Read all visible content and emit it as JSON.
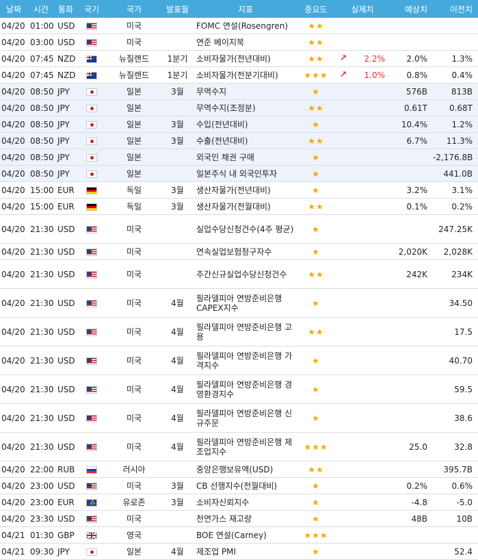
{
  "headers": [
    "날짜",
    "시간",
    "통화",
    "국기",
    "국가",
    "발표월",
    "지표",
    "중요도",
    "실제치",
    "예상치",
    "이전치"
  ],
  "rows": [
    {
      "date": "04/20",
      "time": "01:00",
      "cur": "USD",
      "flag": "us",
      "country": "미국",
      "month": "",
      "indicator": "FOMC 연설(Rosengren)",
      "stars": "★★",
      "arrow": "",
      "actual": "",
      "forecast": "",
      "previous": "",
      "hl": false
    },
    {
      "date": "04/20",
      "time": "03:00",
      "cur": "USD",
      "flag": "us",
      "country": "미국",
      "month": "",
      "indicator": "연준 베이지북",
      "stars": "★★",
      "arrow": "",
      "actual": "",
      "forecast": "",
      "previous": "",
      "hl": false
    },
    {
      "date": "04/20",
      "time": "07:45",
      "cur": "NZD",
      "flag": "nz",
      "country": "뉴질랜드",
      "month": "1분기",
      "indicator": "소비자물가(전년대비)",
      "stars": "★★",
      "arrow": "↗",
      "actual": "2.2%",
      "forecast": "2.0%",
      "previous": "1.3%",
      "hl": false
    },
    {
      "date": "04/20",
      "time": "07:45",
      "cur": "NZD",
      "flag": "nz",
      "country": "뉴질랜드",
      "month": "1분기",
      "indicator": "소비자물가(전분기대비)",
      "stars": "★★★",
      "arrow": "↗",
      "actual": "1.0%",
      "forecast": "0.8%",
      "previous": "0.4%",
      "hl": false
    },
    {
      "date": "04/20",
      "time": "08:50",
      "cur": "JPY",
      "flag": "jp",
      "country": "일본",
      "month": "3월",
      "indicator": "무역수지",
      "stars": "★",
      "arrow": "",
      "actual": "",
      "forecast": "576B",
      "previous": "813B",
      "hl": true
    },
    {
      "date": "04/20",
      "time": "08:50",
      "cur": "JPY",
      "flag": "jp",
      "country": "일본",
      "month": "",
      "indicator": "무역수지(조정분)",
      "stars": "★★",
      "arrow": "",
      "actual": "",
      "forecast": "0.61T",
      "previous": "0.68T",
      "hl": true
    },
    {
      "date": "04/20",
      "time": "08:50",
      "cur": "JPY",
      "flag": "jp",
      "country": "일본",
      "month": "3월",
      "indicator": "수입(전년대비)",
      "stars": "★",
      "arrow": "",
      "actual": "",
      "forecast": "10.4%",
      "previous": "1.2%",
      "hl": true
    },
    {
      "date": "04/20",
      "time": "08:50",
      "cur": "JPY",
      "flag": "jp",
      "country": "일본",
      "month": "3월",
      "indicator": "수출(전년대비)",
      "stars": "★★",
      "arrow": "",
      "actual": "",
      "forecast": "6.7%",
      "previous": "11.3%",
      "hl": true
    },
    {
      "date": "04/20",
      "time": "08:50",
      "cur": "JPY",
      "flag": "jp",
      "country": "일본",
      "month": "",
      "indicator": "외국인 채권 구매",
      "stars": "★",
      "arrow": "",
      "actual": "",
      "forecast": "",
      "previous": "-2,176.8B",
      "hl": true
    },
    {
      "date": "04/20",
      "time": "08:50",
      "cur": "JPY",
      "flag": "jp",
      "country": "일본",
      "month": "",
      "indicator": "일본주식 내 외국인투자",
      "stars": "★",
      "arrow": "",
      "actual": "",
      "forecast": "",
      "previous": "441.0B",
      "hl": true
    },
    {
      "date": "04/20",
      "time": "15:00",
      "cur": "EUR",
      "flag": "de",
      "country": "독일",
      "month": "3월",
      "indicator": "생산자물가(전년대비)",
      "stars": "★",
      "arrow": "",
      "actual": "",
      "forecast": "3.2%",
      "previous": "3.1%",
      "hl": false
    },
    {
      "date": "04/20",
      "time": "15:00",
      "cur": "EUR",
      "flag": "de",
      "country": "독일",
      "month": "3월",
      "indicator": "생산자물가(전월대비)",
      "stars": "★★",
      "arrow": "",
      "actual": "",
      "forecast": "0.1%",
      "previous": "0.2%",
      "hl": false
    },
    {
      "date": "04/20",
      "time": "21:30",
      "cur": "USD",
      "flag": "us",
      "country": "미국",
      "month": "",
      "indicator": "실업수당신청건수(4주 평균)",
      "stars": "★",
      "arrow": "",
      "actual": "",
      "forecast": "",
      "previous": "247.25K",
      "hl": false,
      "tall": true
    },
    {
      "date": "04/20",
      "time": "21:30",
      "cur": "USD",
      "flag": "us",
      "country": "미국",
      "month": "",
      "indicator": "연속실업보험청구자수",
      "stars": "★",
      "arrow": "",
      "actual": "",
      "forecast": "2,020K",
      "previous": "2,028K",
      "hl": false
    },
    {
      "date": "04/20",
      "time": "21:30",
      "cur": "USD",
      "flag": "us",
      "country": "미국",
      "month": "",
      "indicator": "주간신규실업수당신청건수",
      "stars": "★★",
      "arrow": "",
      "actual": "",
      "forecast": "242K",
      "previous": "234K",
      "hl": false,
      "tall": true
    },
    {
      "date": "04/20",
      "time": "21:30",
      "cur": "USD",
      "flag": "us",
      "country": "미국",
      "month": "4월",
      "indicator": "필라델피아 연방준비은행 CAPEX지수",
      "stars": "★",
      "arrow": "",
      "actual": "",
      "forecast": "",
      "previous": "34.50",
      "hl": false,
      "tall": true
    },
    {
      "date": "04/20",
      "time": "21:30",
      "cur": "USD",
      "flag": "us",
      "country": "미국",
      "month": "4월",
      "indicator": "필라델피아 연방준비은행 고용",
      "stars": "★★",
      "arrow": "",
      "actual": "",
      "forecast": "",
      "previous": "17.5",
      "hl": false,
      "tall": true
    },
    {
      "date": "04/20",
      "time": "21:30",
      "cur": "USD",
      "flag": "us",
      "country": "미국",
      "month": "4월",
      "indicator": "필라델피아 연방준비은행 가격지수",
      "stars": "★",
      "arrow": "",
      "actual": "",
      "forecast": "",
      "previous": "40.70",
      "hl": false,
      "tall": true
    },
    {
      "date": "04/20",
      "time": "21:30",
      "cur": "USD",
      "flag": "us",
      "country": "미국",
      "month": "4월",
      "indicator": "필라델피아 연방준비은행 경영환경지수",
      "stars": "★",
      "arrow": "",
      "actual": "",
      "forecast": "",
      "previous": "59.5",
      "hl": false,
      "tall": true
    },
    {
      "date": "04/20",
      "time": "21:30",
      "cur": "USD",
      "flag": "us",
      "country": "미국",
      "month": "4월",
      "indicator": "필라델피아 연방준비은행 신규주문",
      "stars": "★",
      "arrow": "",
      "actual": "",
      "forecast": "",
      "previous": "38.6",
      "hl": false,
      "tall": true
    },
    {
      "date": "04/20",
      "time": "21:30",
      "cur": "USD",
      "flag": "us",
      "country": "미국",
      "month": "4월",
      "indicator": "필라델피아 연방준비은행 제조업지수",
      "stars": "★★★",
      "arrow": "",
      "actual": "",
      "forecast": "25.0",
      "previous": "32.8",
      "hl": false,
      "tall": true
    },
    {
      "date": "04/20",
      "time": "22:00",
      "cur": "RUB",
      "flag": "ru",
      "country": "러시아",
      "month": "",
      "indicator": "중앙은행보유액(USD)",
      "stars": "★★",
      "arrow": "",
      "actual": "",
      "forecast": "",
      "previous": "395.7B",
      "hl": false
    },
    {
      "date": "04/20",
      "time": "23:00",
      "cur": "USD",
      "flag": "us",
      "country": "미국",
      "month": "3월",
      "indicator": "CB 선행지수(전월대비)",
      "stars": "★",
      "arrow": "",
      "actual": "",
      "forecast": "0.2%",
      "previous": "0.6%",
      "hl": false
    },
    {
      "date": "04/20",
      "time": "23:00",
      "cur": "EUR",
      "flag": "eu",
      "country": "유로존",
      "month": "3월",
      "indicator": "소비자신뢰지수",
      "stars": "★",
      "arrow": "",
      "actual": "",
      "forecast": "-4.8",
      "previous": "-5.0",
      "hl": false
    },
    {
      "date": "04/20",
      "time": "23:30",
      "cur": "USD",
      "flag": "us",
      "country": "미국",
      "month": "",
      "indicator": "천연가스 재고량",
      "stars": "★",
      "arrow": "",
      "actual": "",
      "forecast": "48B",
      "previous": "10B",
      "hl": false
    },
    {
      "date": "04/21",
      "time": "01:30",
      "cur": "GBP",
      "flag": "gb",
      "country": "영국",
      "month": "",
      "indicator": "BOE 연설(Carney)",
      "stars": "★★★",
      "arrow": "",
      "actual": "",
      "forecast": "",
      "previous": "",
      "hl": false
    },
    {
      "date": "04/21",
      "time": "09:30",
      "cur": "JPY",
      "flag": "jp",
      "country": "일본",
      "month": "4월",
      "indicator": "제조업 PMI",
      "stars": "★",
      "arrow": "",
      "actual": "",
      "forecast": "",
      "previous": "52.4",
      "hl": false
    }
  ]
}
